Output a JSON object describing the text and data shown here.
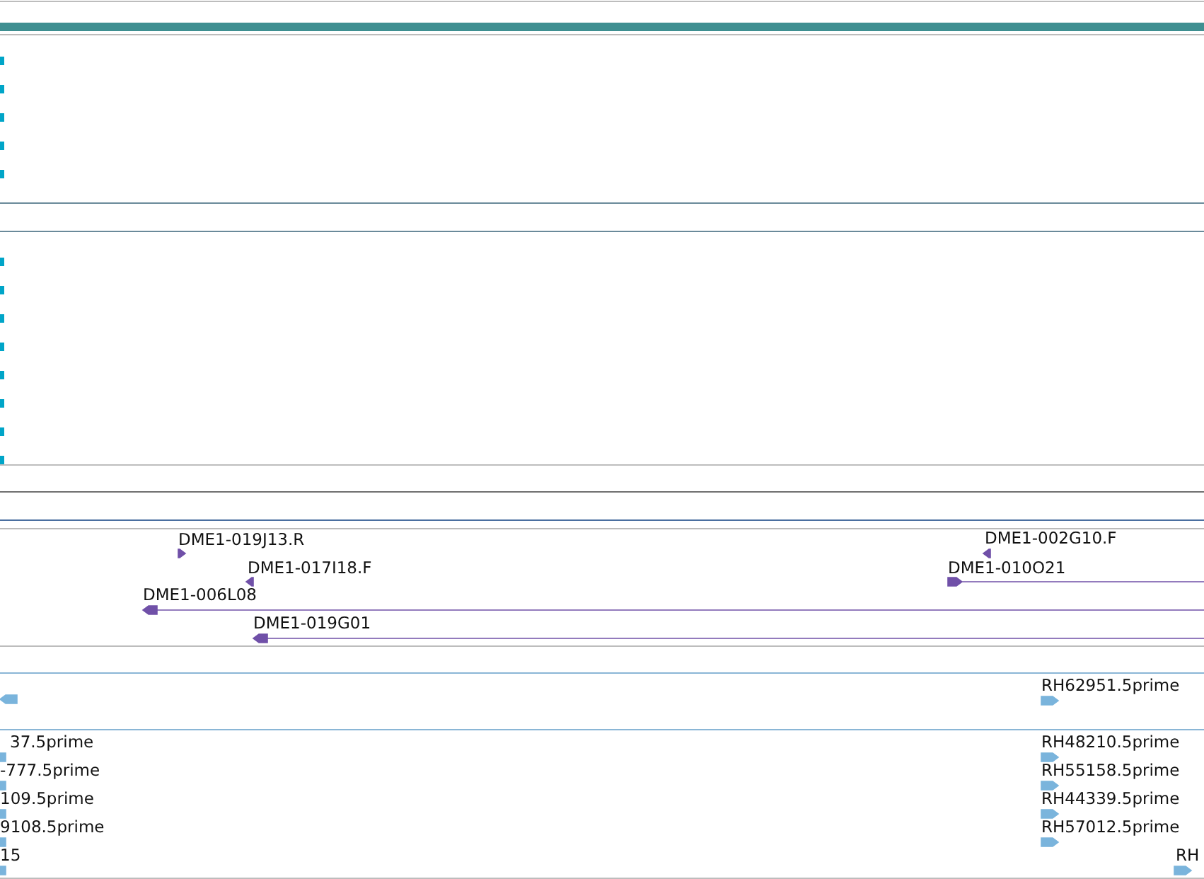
{
  "tracks": [
    {
      "kind": "ticks"
    },
    {
      "kind": "ticks"
    },
    {
      "kind": "features",
      "color": "#7050a8",
      "features": [
        {
          "label": "DME1-019J13.R",
          "reverse": false
        },
        {
          "label": "DME1-017I18.F",
          "reverse": true
        },
        {
          "label": "DME1-006L08",
          "reverse": true
        },
        {
          "label": "DME1-019G01",
          "reverse": true
        },
        {
          "label": "DME1-002G10.F",
          "reverse": true
        },
        {
          "label": "DME1-010O21",
          "reverse": false
        }
      ]
    },
    {
      "kind": "features",
      "color": "#7ab4dc",
      "features": [
        {
          "reverse": true
        },
        {
          "label": "RH62951.5prime",
          "reverse": false
        }
      ]
    },
    {
      "kind": "features",
      "color": "#7ab4dc",
      "features": [
        {
          "label": "37.5prime"
        },
        {
          "label": "-777.5prime"
        },
        {
          "label": "109.5prime"
        },
        {
          "label": "9108.5prime"
        },
        {
          "label": "15"
        },
        {
          "label": "RH48210.5prime",
          "reverse": false
        },
        {
          "label": "RH55158.5prime",
          "reverse": false
        },
        {
          "label": "RH44339.5prime",
          "reverse": false
        },
        {
          "label": "RH57012.5prime",
          "reverse": false
        },
        {
          "label": "RH",
          "reverse": false
        }
      ]
    }
  ]
}
